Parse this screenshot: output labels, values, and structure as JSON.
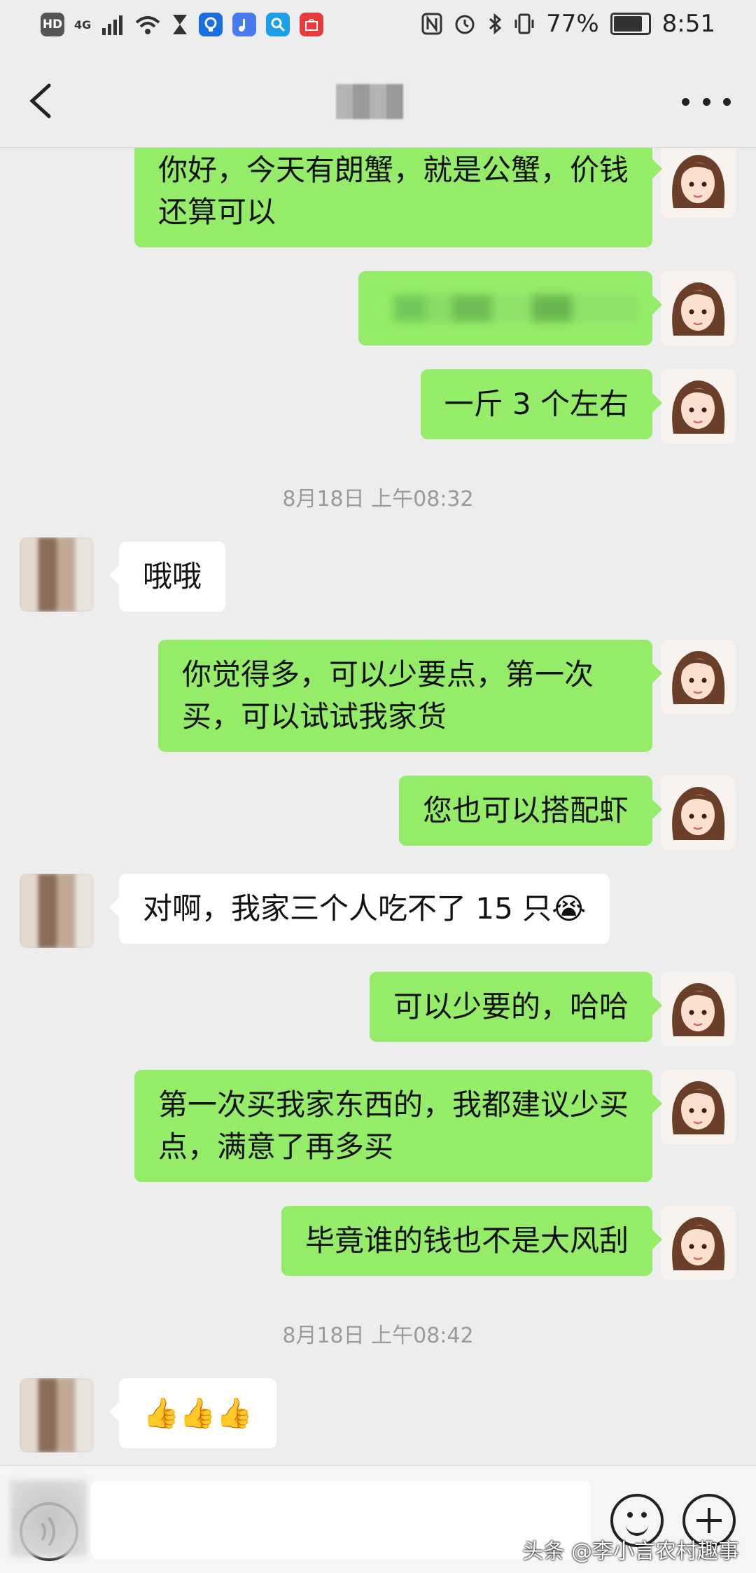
{
  "status_bar": {
    "left_labels": [
      "HD",
      "4G"
    ],
    "battery": "77%",
    "time": "8:51"
  },
  "nav": {
    "back_icon": "chevron-left-icon",
    "more_icon": "more-dots-icon"
  },
  "messages": [
    {
      "side": "me",
      "text": "你好，今天有朗蟹，就是公蟹，价钱还算可以"
    },
    {
      "side": "me",
      "text": ""
    },
    {
      "side": "me",
      "text": "一斤 3 个左右"
    },
    {
      "timestamp": "8月18日 上午08:32"
    },
    {
      "side": "other",
      "text": "哦哦"
    },
    {
      "side": "me",
      "text": "你觉得多，可以少要点，第一次买，可以试试我家货"
    },
    {
      "side": "me",
      "text": "您也可以搭配虾"
    },
    {
      "side": "other",
      "text": "对啊，我家三个人吃不了 15 只😭"
    },
    {
      "side": "me",
      "text": "可以少要的，哈哈"
    },
    {
      "side": "me",
      "text": "第一次买我家东西的，我都建议少买点，满意了再多买"
    },
    {
      "side": "me",
      "text": "毕竟谁的钱也不是大风刮"
    },
    {
      "timestamp": "8月18日 上午08:42"
    },
    {
      "side": "other",
      "text": "👍👍👍"
    }
  ],
  "input_bar": {
    "voice_icon": "voice-icon",
    "emoji_icon": "emoji-icon",
    "plus_icon": "plus-icon"
  },
  "watermark": "头条 @李小言农村趣事",
  "colors": {
    "bubble_me": "#95ec69",
    "bubble_other": "#ffffff",
    "background": "#ededed"
  }
}
